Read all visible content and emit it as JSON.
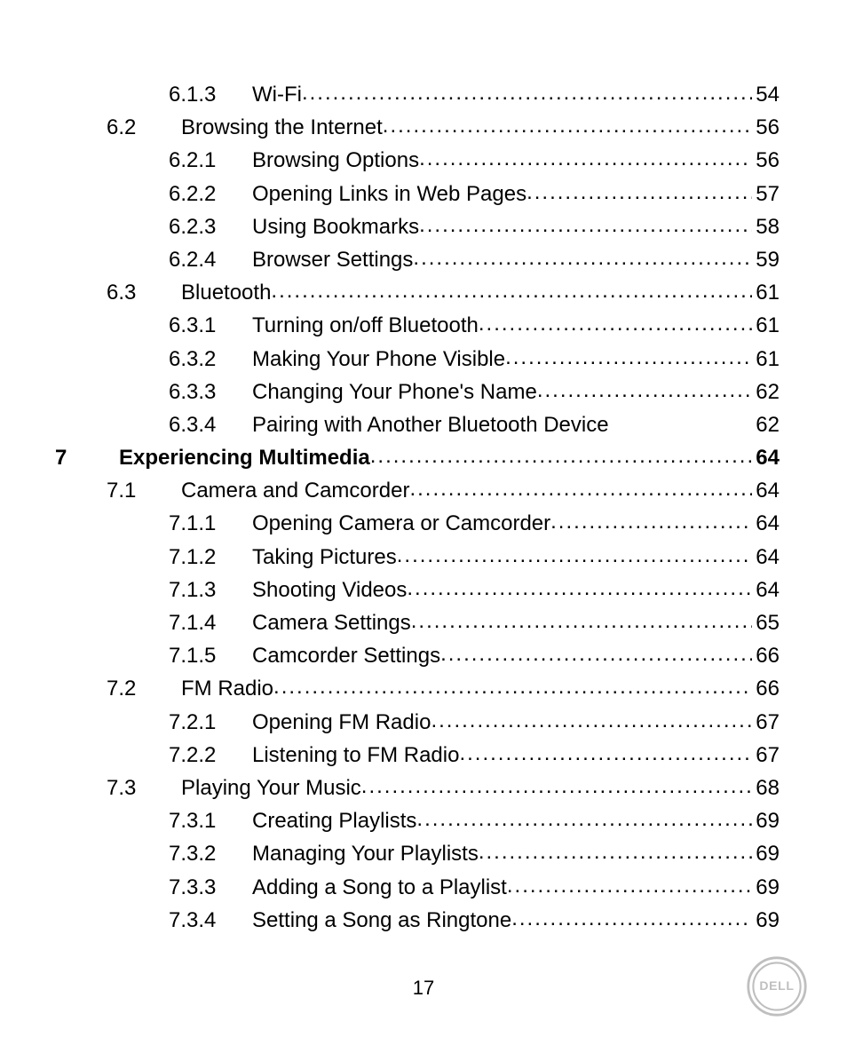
{
  "page_number": "17",
  "brand": "DELL",
  "entries": [
    {
      "level": 3,
      "num": "6.1.3",
      "title": "Wi-Fi",
      "page": "54",
      "bold": false
    },
    {
      "level": 2,
      "num": "6.2",
      "title": "Browsing the Internet",
      "page": "56",
      "bold": false
    },
    {
      "level": 3,
      "num": "6.2.1",
      "title": "Browsing Options",
      "page": "56",
      "bold": false
    },
    {
      "level": 3,
      "num": "6.2.2",
      "title": "Opening Links in Web Pages",
      "page": "57",
      "bold": false
    },
    {
      "level": 3,
      "num": "6.2.3",
      "title": "Using Bookmarks",
      "page": "58",
      "bold": false
    },
    {
      "level": 3,
      "num": "6.2.4",
      "title": "Browser Settings",
      "page": "59",
      "bold": false
    },
    {
      "level": 2,
      "num": "6.3",
      "title": "Bluetooth",
      "page": "61",
      "bold": false
    },
    {
      "level": 3,
      "num": "6.3.1",
      "title": "Turning on/off Bluetooth",
      "page": "61",
      "bold": false
    },
    {
      "level": 3,
      "num": "6.3.2",
      "title": "Making Your Phone Visible",
      "page": "61",
      "bold": false
    },
    {
      "level": 3,
      "num": "6.3.3",
      "title": "Changing Your Phone's Name",
      "page": "62",
      "bold": false
    },
    {
      "level": 3,
      "num": "6.3.4",
      "title": "Pairing with Another Bluetooth Device",
      "page": "62",
      "bold": false,
      "nolead": true
    },
    {
      "level": 1,
      "num": "7",
      "title": "Experiencing Multimedia",
      "page": "64",
      "bold": true
    },
    {
      "level": 2,
      "num": "7.1",
      "title": "Camera and Camcorder",
      "page": "64",
      "bold": false
    },
    {
      "level": 3,
      "num": "7.1.1",
      "title": "Opening Camera or Camcorder",
      "page": "64",
      "bold": false
    },
    {
      "level": 3,
      "num": "7.1.2",
      "title": "Taking Pictures",
      "page": "64",
      "bold": false
    },
    {
      "level": 3,
      "num": "7.1.3",
      "title": "Shooting Videos",
      "page": "64",
      "bold": false
    },
    {
      "level": 3,
      "num": "7.1.4",
      "title": "Camera Settings",
      "page": "65",
      "bold": false
    },
    {
      "level": 3,
      "num": "7.1.5",
      "title": "Camcorder Settings",
      "page": "66",
      "bold": false
    },
    {
      "level": 2,
      "num": "7.2",
      "title": "FM Radio",
      "page": "66",
      "bold": false
    },
    {
      "level": 3,
      "num": "7.2.1",
      "title": "Opening FM Radio",
      "page": "67",
      "bold": false
    },
    {
      "level": 3,
      "num": "7.2.2",
      "title": "Listening to FM Radio",
      "page": "67",
      "bold": false
    },
    {
      "level": 2,
      "num": "7.3",
      "title": "Playing Your Music",
      "page": "68",
      "bold": false
    },
    {
      "level": 3,
      "num": "7.3.1",
      "title": "Creating Playlists",
      "page": "69",
      "bold": false
    },
    {
      "level": 3,
      "num": "7.3.2",
      "title": "Managing Your Playlists",
      "page": "69",
      "bold": false
    },
    {
      "level": 3,
      "num": "7.3.3",
      "title": "Adding a Song to a Playlist",
      "page": "69",
      "bold": false
    },
    {
      "level": 3,
      "num": "7.3.4",
      "title": "Setting a Song as Ringtone",
      "page": "69",
      "bold": false
    }
  ]
}
